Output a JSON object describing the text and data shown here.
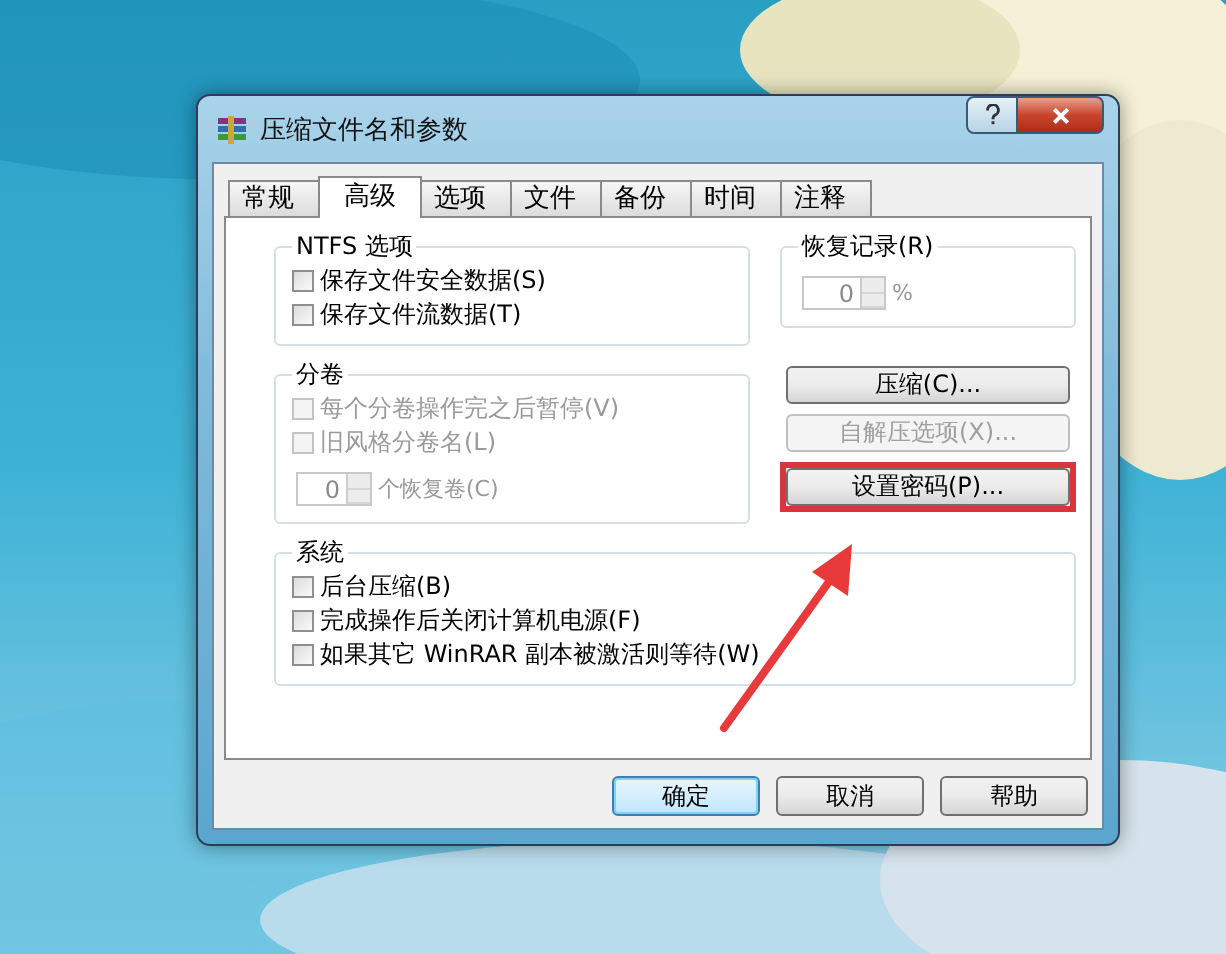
{
  "window": {
    "title": "压缩文件名和参数"
  },
  "tabs": [
    {
      "label": "常规",
      "selected": false
    },
    {
      "label": "高级",
      "selected": true
    },
    {
      "label": "选项",
      "selected": false
    },
    {
      "label": "文件",
      "selected": false
    },
    {
      "label": "备份",
      "selected": false
    },
    {
      "label": "时间",
      "selected": false
    },
    {
      "label": "注释",
      "selected": false
    }
  ],
  "ntfs": {
    "title": "NTFS 选项",
    "options": [
      {
        "label": "保存文件安全数据(S)",
        "checked": false,
        "disabled": false
      },
      {
        "label": "保存文件流数据(T)",
        "checked": false,
        "disabled": false
      }
    ]
  },
  "recovery": {
    "title": "恢复记录(R)",
    "spinner": {
      "value": "0",
      "unit": "%",
      "disabled": true
    }
  },
  "volumes": {
    "title": "分卷",
    "options": [
      {
        "label": "每个分卷操作完之后暂停(V)",
        "checked": false,
        "disabled": true
      },
      {
        "label": "旧风格分卷名(L)",
        "checked": false,
        "disabled": true
      }
    ],
    "spinner": {
      "value": "0",
      "unit": "个恢复卷(C)",
      "disabled": true
    }
  },
  "actions": [
    {
      "label": "压缩(C)...",
      "disabled": false,
      "highlighted": false
    },
    {
      "label": "自解压选项(X)...",
      "disabled": true,
      "highlighted": false
    },
    {
      "label": "设置密码(P)...",
      "disabled": false,
      "highlighted": true
    }
  ],
  "system": {
    "title": "系统",
    "options": [
      {
        "label": "后台压缩(B)",
        "checked": false,
        "disabled": false
      },
      {
        "label": "完成操作后关闭计算机电源(F)",
        "checked": false,
        "disabled": false
      },
      {
        "label": "如果其它 WinRAR 副本被激活则等待(W)",
        "checked": false,
        "disabled": false
      }
    ]
  },
  "footer_buttons": [
    {
      "label": "确定",
      "default": true
    },
    {
      "label": "取消",
      "default": false
    },
    {
      "label": "帮助",
      "default": false
    }
  ]
}
